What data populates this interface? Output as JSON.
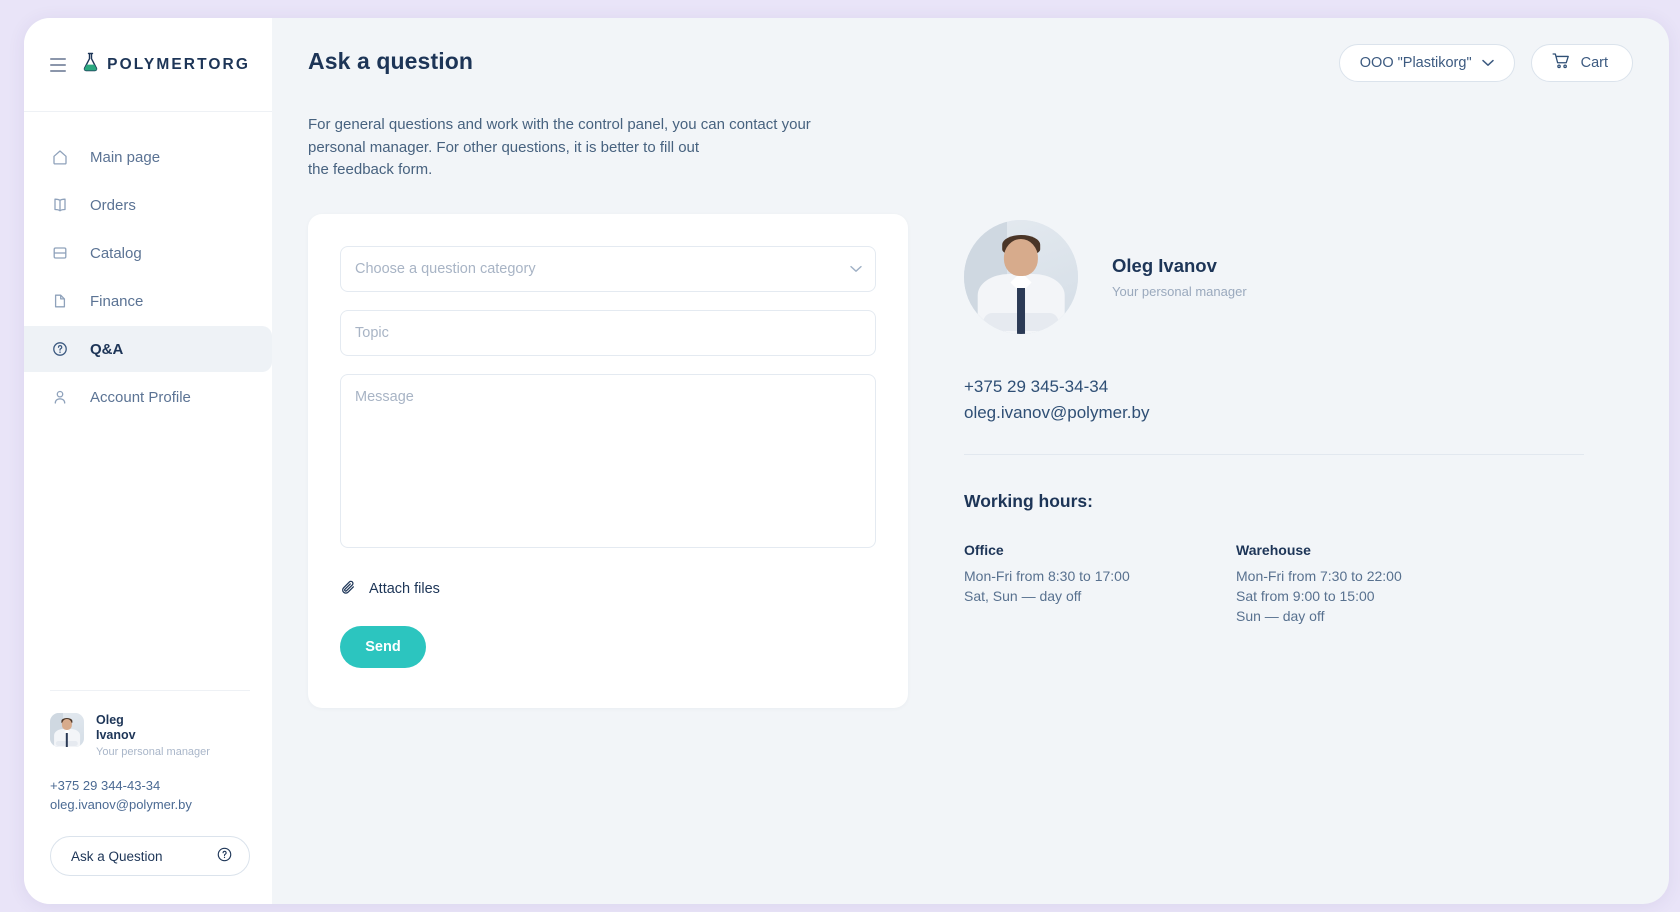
{
  "brand": {
    "name": "POLYMERTORG",
    "logo_icon": "flask-icon"
  },
  "sidebar": {
    "menu_icon": "hamburger-icon",
    "items": [
      {
        "label": "Main page",
        "icon": "home-icon",
        "active": false
      },
      {
        "label": "Orders",
        "icon": "book-icon",
        "active": false
      },
      {
        "label": "Catalog",
        "icon": "catalog-icon",
        "active": false
      },
      {
        "label": "Finance",
        "icon": "document-icon",
        "active": false
      },
      {
        "label": "Q&A",
        "icon": "question-circle-icon",
        "active": true
      },
      {
        "label": "Account Profile",
        "icon": "user-icon",
        "active": false
      }
    ],
    "manager": {
      "first_name": "Oleg",
      "last_name": "Ivanov",
      "role": "Your personal manager",
      "phone": "+375 29 344-43-34",
      "email": "oleg.ivanov@polymer.by"
    },
    "ask_button": {
      "label": "Ask a Question",
      "icon": "question-circle-icon"
    }
  },
  "header": {
    "title": "Ask a question",
    "company": {
      "label": "OOO \"Plastikorg\"",
      "icon": "chevron-down-icon"
    },
    "cart": {
      "label": "Cart",
      "icon": "cart-icon"
    }
  },
  "intro": {
    "line1": "For general questions and work with the control panel, you can contact your",
    "line2": "personal manager. For other questions, it is better to fill out",
    "line3": "the feedback form."
  },
  "form": {
    "category": {
      "placeholder": "Choose a question category",
      "value": "",
      "chevron": "chevron-down-icon"
    },
    "topic": {
      "placeholder": "Topic",
      "value": ""
    },
    "message": {
      "placeholder": "Message",
      "value": ""
    },
    "attach": {
      "label": "Attach files",
      "icon": "paperclip-icon"
    },
    "submit": {
      "label": "Send"
    }
  },
  "manager_panel": {
    "name": "Oleg Ivanov",
    "role": "Your personal manager",
    "phone": "+375 29 345-34-34",
    "email": "oleg.ivanov@polymer.by"
  },
  "working_hours": {
    "title": "Working hours:",
    "columns": [
      {
        "name": "Office",
        "lines": [
          "Mon-Fri from 8:30 to 17:00",
          "Sat, Sun — day off"
        ]
      },
      {
        "name": "Warehouse",
        "lines": [
          "Mon-Fri from 7:30 to 22:00",
          "Sat from 9:00 to 15:00",
          "Sun — day off"
        ]
      }
    ]
  },
  "colors": {
    "accent_teal": "#2cc5bf",
    "brand_navy": "#1d3557",
    "page_bg": "#f2f5f8",
    "desktop_bg": "#e9e4f8",
    "logo_green": "#2aa87f"
  }
}
